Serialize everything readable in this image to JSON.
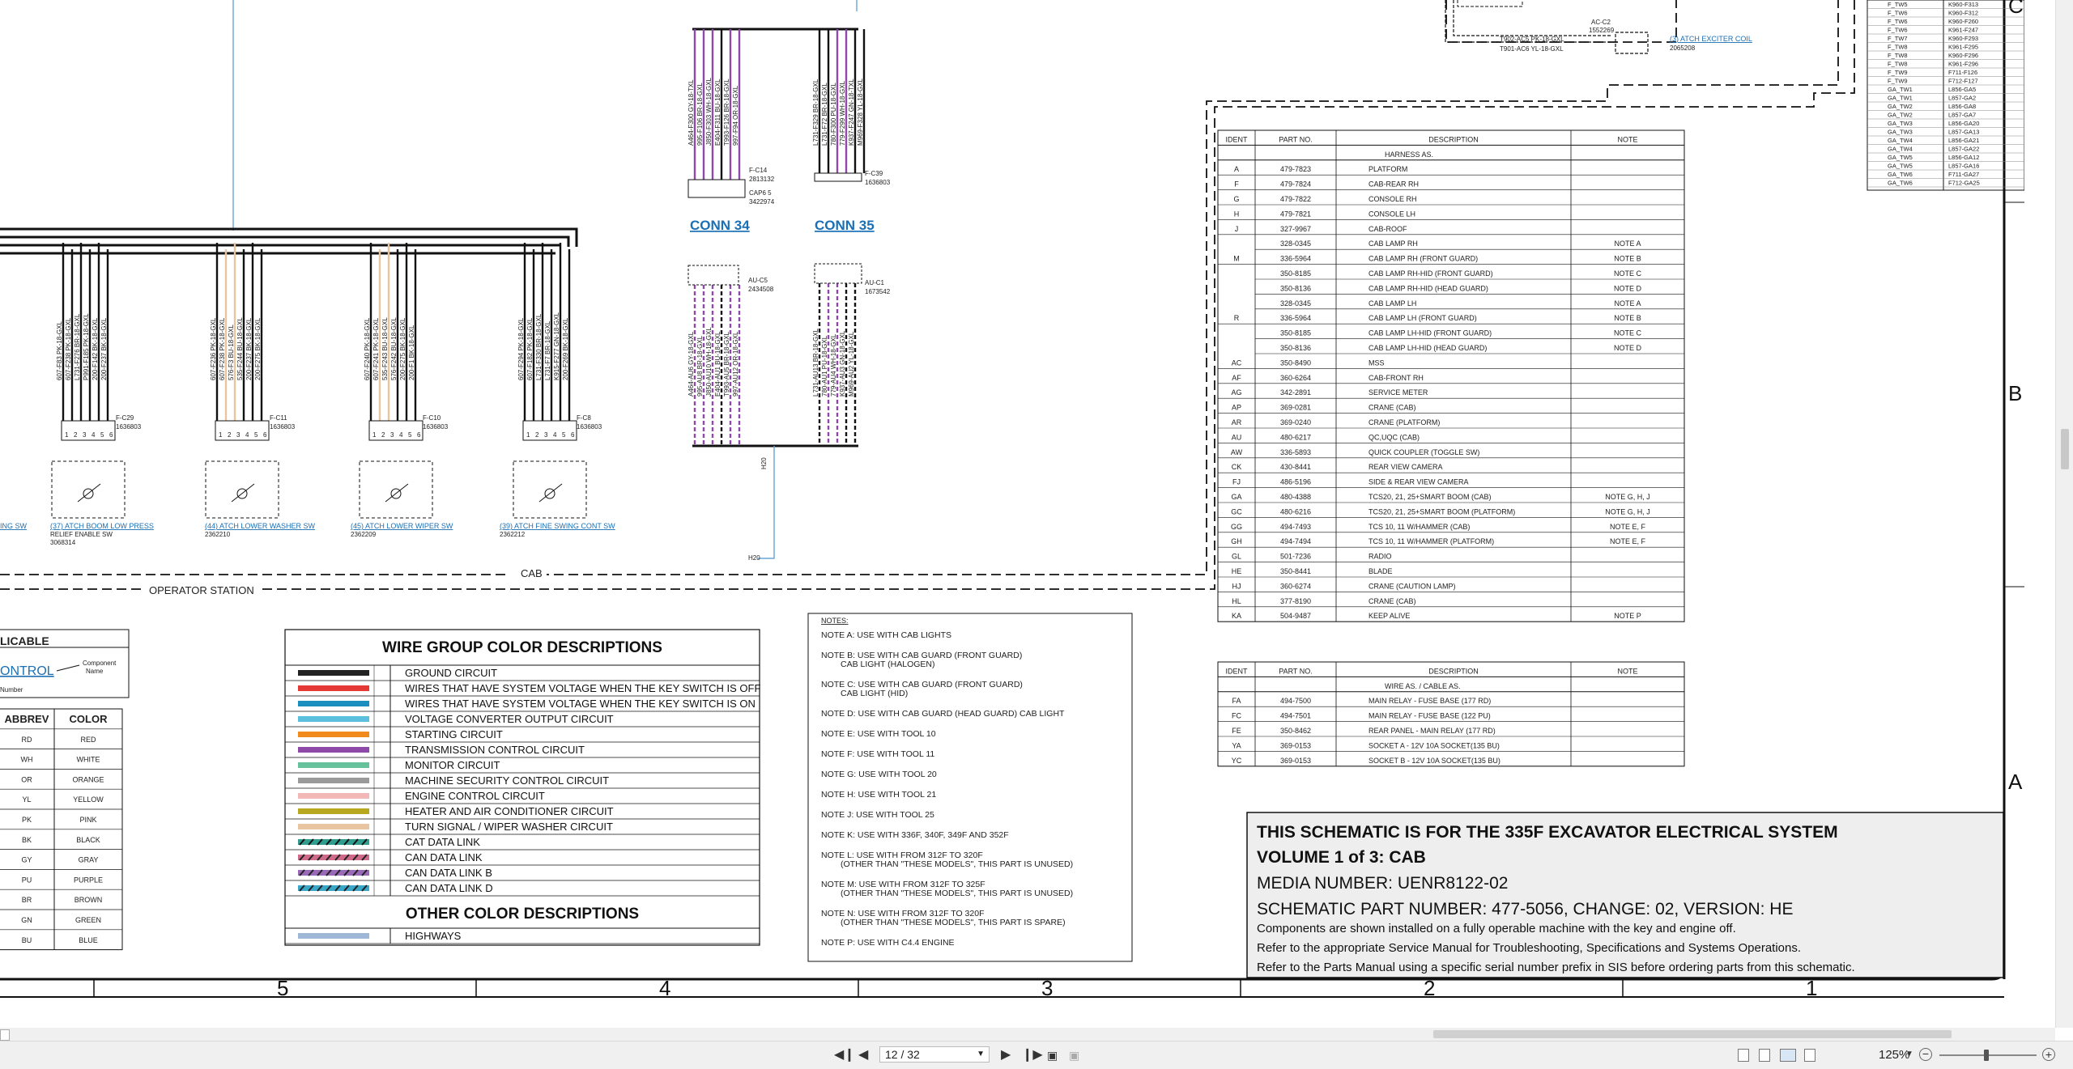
{
  "connectors": {
    "conn34": "CONN 34",
    "conn35": "CONN 35",
    "fc14": "F-C14",
    "fc14pn": "2813132",
    "cap": "CAP6 5",
    "cappn": "3422974",
    "fc39": "F-C39",
    "fc39pn": "1636803",
    "auc5": "AU-C5",
    "auc5pn": "2434508",
    "auc1": "AU-C1",
    "auc1pn": "1673542",
    "fc29": "F-C29",
    "fc29pn": "1636803",
    "fc11": "F-C11",
    "fc11pn": "1636803",
    "fc10": "F-C10",
    "fc10pn": "1636803",
    "fc8": "F-C8",
    "fc8pn": "1636803",
    "acc2": "AC-C2",
    "acc2pn": "1552269",
    "h20": "H20"
  },
  "switches": {
    "sw1": "(37) ATCH BOOM LOW PRESS",
    "sw1b": "RELIEF ENABLE SW",
    "sw1pn": "3068314",
    "sw2": "(44) ATCH LOWER WASHER SW",
    "sw2pn": "2362210",
    "sw3": "(45) ATCH LOWER WIPER SW",
    "sw3pn": "2362209",
    "sw4": "(39) ATCH FINE SWING CONT SW",
    "sw4pn": "2362212",
    "sw0": "ING SW",
    "exciter": "(3) ATCH EXCITER COIL",
    "exciterpn": "2065208",
    "w1": "T902-AC5 PK-18-GXL",
    "w2": "T901-AC6 YL-18-GXL"
  },
  "labels": {
    "cab": "CAB",
    "operator": "OPERATOR STATION"
  },
  "wire_group": {
    "title": "WIRE GROUP COLOR DESCRIPTIONS",
    "rows": [
      {
        "label": "GROUND CIRCUIT",
        "color": "#222222"
      },
      {
        "label": "WIRES THAT HAVE SYSTEM VOLTAGE WHEN THE KEY SWITCH IS OFF",
        "color": "#e53935"
      },
      {
        "label": "WIRES THAT HAVE SYSTEM VOLTAGE WHEN THE KEY SWITCH IS ON",
        "color": "#1a8fbf"
      },
      {
        "label": "VOLTAGE CONVERTER OUTPUT CIRCUIT",
        "color": "#5bc0de"
      },
      {
        "label": "STARTING CIRCUIT",
        "color": "#f08a1c"
      },
      {
        "label": "TRANSMISSION CONTROL CIRCUIT",
        "color": "#8e4aa8"
      },
      {
        "label": "MONITOR CIRCUIT",
        "color": "#66c29a"
      },
      {
        "label": "MACHINE SECURITY CONTROL CIRCUIT",
        "color": "#9a9a9a"
      },
      {
        "label": "ENGINE CONTROL CIRCUIT",
        "color": "#f2b7b7"
      },
      {
        "label": "HEATER AND AIR CONDITIONER CIRCUIT",
        "color": "#b8a820"
      },
      {
        "label": "TURN SIGNAL / WIPER WASHER CIRCUIT",
        "color": "#e8c4a0"
      },
      {
        "label": "CAT DATA LINK",
        "color": "#2f9e8f"
      },
      {
        "label": "CAN DATA LINK",
        "color": "#d06a8a"
      },
      {
        "label": "CAN DATA LINK B",
        "color": "#9a6ab8"
      },
      {
        "label": "CAN DATA LINK D",
        "color": "#3aa6c8"
      }
    ],
    "other_title": "OTHER COLOR DESCRIPTIONS",
    "other": [
      {
        "label": "HIGHWAYS",
        "color": "#9fb8d8"
      }
    ]
  },
  "applicable": {
    "title": "LICABLE",
    "control": "ONTROL",
    "component": "Component",
    "name": "Name",
    "number": "Number"
  },
  "color_table": {
    "headers": [
      "ABBREV",
      "COLOR"
    ],
    "rows": [
      [
        "RD",
        "RED"
      ],
      [
        "WH",
        "WHITE"
      ],
      [
        "OR",
        "ORANGE"
      ],
      [
        "YL",
        "YELLOW"
      ],
      [
        "PK",
        "PINK"
      ],
      [
        "BK",
        "BLACK"
      ],
      [
        "GY",
        "GRAY"
      ],
      [
        "PU",
        "PURPLE"
      ],
      [
        "BR",
        "BROWN"
      ],
      [
        "GN",
        "GREEN"
      ],
      [
        "BU",
        "BLUE"
      ]
    ]
  },
  "notes": {
    "title": "NOTES:",
    "items": [
      [
        "NOTE A: USE WITH CAB LIGHTS"
      ],
      [
        "NOTE B: USE WITH CAB GUARD (FRONT GUARD)",
        "CAB LIGHT (HALOGEN)"
      ],
      [
        "NOTE C: USE WITH CAB GUARD (FRONT GUARD)",
        "CAB LIGHT (HID)"
      ],
      [
        "NOTE D: USE WITH CAB GUARD (HEAD GUARD) CAB LIGHT"
      ],
      [
        "NOTE E: USE WITH TOOL 10"
      ],
      [
        "NOTE F: USE WITH TOOL 11"
      ],
      [
        "NOTE G: USE WITH TOOL 20"
      ],
      [
        "NOTE H: USE WITH TOOL 21"
      ],
      [
        "NOTE J: USE WITH TOOL 25"
      ],
      [
        "NOTE K: USE WITH 336F, 340F, 349F AND 352F"
      ],
      [
        "NOTE L: USE WITH FROM 312F TO 320F",
        "(OTHER THAN \"THESE MODELS\", THIS PART IS UNUSED)"
      ],
      [
        "NOTE M: USE WITH FROM 312F TO 325F",
        "(OTHER THAN \"THESE MODELS\", THIS PART IS UNUSED)"
      ],
      [
        "NOTE N: USE WITH FROM 312F TO 320F",
        "(OTHER THAN \"THESE MODELS\", THIS PART IS SPARE)"
      ],
      [
        "NOTE P: USE WITH C4.4 ENGINE"
      ]
    ]
  },
  "harness": {
    "headers": [
      "IDENT",
      "PART NO.",
      "DESCRIPTION",
      "NOTE"
    ],
    "subtitle": "HARNESS AS.",
    "rows": [
      [
        "A",
        "479-7823",
        "PLATFORM",
        ""
      ],
      [
        "F",
        "479-7824",
        "CAB-REAR RH",
        ""
      ],
      [
        "G",
        "479-7822",
        "CONSOLE RH",
        ""
      ],
      [
        "H",
        "479-7821",
        "CONSOLE LH",
        ""
      ],
      [
        "J",
        "327-9967",
        "CAB-ROOF",
        ""
      ],
      [
        "",
        "328-0345",
        "CAB LAMP RH",
        "NOTE A"
      ],
      [
        "M",
        "336-5964",
        "CAB LAMP RH (FRONT GUARD)",
        "NOTE B"
      ],
      [
        "",
        "350-8185",
        "CAB LAMP RH-HID (FRONT GUARD)",
        "NOTE C"
      ],
      [
        "",
        "350-8136",
        "CAB LAMP RH-HID (HEAD GUARD)",
        "NOTE D"
      ],
      [
        "",
        "328-0345",
        "CAB LAMP LH",
        "NOTE A"
      ],
      [
        "R",
        "336-5964",
        "CAB LAMP LH (FRONT GUARD)",
        "NOTE B"
      ],
      [
        "",
        "350-8185",
        "CAB LAMP LH-HID (FRONT GUARD)",
        "NOTE C"
      ],
      [
        "",
        "350-8136",
        "CAB LAMP LH-HID (HEAD GUARD)",
        "NOTE D"
      ],
      [
        "AC",
        "350-8490",
        "MSS",
        ""
      ],
      [
        "AF",
        "360-6264",
        "CAB-FRONT RH",
        ""
      ],
      [
        "AG",
        "342-2891",
        "SERVICE METER",
        ""
      ],
      [
        "AP",
        "369-0281",
        "CRANE (CAB)",
        ""
      ],
      [
        "AR",
        "369-0240",
        "CRANE (PLATFORM)",
        ""
      ],
      [
        "AU",
        "480-6217",
        "QC,UQC (CAB)",
        ""
      ],
      [
        "AW",
        "336-5893",
        "QUICK COUPLER (TOGGLE SW)",
        ""
      ],
      [
        "CK",
        "430-8441",
        "REAR VIEW CAMERA",
        ""
      ],
      [
        "FJ",
        "486-5196",
        "SIDE & REAR VIEW CAMERA",
        ""
      ],
      [
        "GA",
        "480-4388",
        "TCS20, 21, 25+SMART BOOM (CAB)",
        "NOTE G, H, J"
      ],
      [
        "GC",
        "480-6216",
        "TCS20, 21, 25+SMART BOOM (PLATFORM)",
        "NOTE G, H, J"
      ],
      [
        "GG",
        "494-7493",
        "TCS 10, 11 W/HAMMER (CAB)",
        "NOTE E, F"
      ],
      [
        "GH",
        "494-7494",
        "TCS 10, 11 W/HAMMER (PLATFORM)",
        "NOTE E, F"
      ],
      [
        "GL",
        "501-7236",
        "RADIO",
        ""
      ],
      [
        "HE",
        "350-8441",
        "BLADE",
        ""
      ],
      [
        "HJ",
        "360-6274",
        "CRANE (CAUTION LAMP)",
        ""
      ],
      [
        "HL",
        "377-8190",
        "CRANE (CAB)",
        ""
      ],
      [
        "KA",
        "504-9487",
        "KEEP ALIVE",
        "NOTE P"
      ]
    ]
  },
  "wire_as": {
    "headers": [
      "IDENT",
      "PART NO.",
      "DESCRIPTION",
      "NOTE"
    ],
    "subtitle": "WIRE AS. / CABLE AS.",
    "rows": [
      [
        "FA",
        "494-7500",
        "MAIN RELAY - FUSE BASE (177 RD)",
        ""
      ],
      [
        "FC",
        "494-7501",
        "MAIN RELAY - FUSE BASE (122 PU)",
        ""
      ],
      [
        "FE",
        "350-8462",
        "REAR PANEL - MAIN RELAY (177 RD)",
        ""
      ],
      [
        "YA",
        "369-0153",
        "SOCKET A - 12V 10A SOCKET(135 BU)",
        ""
      ],
      [
        "YC",
        "369-0153",
        "SOCKET B - 12V 10A SOCKET(135 BU)",
        ""
      ]
    ]
  },
  "twist_table": {
    "rows": [
      [
        "F_TW5",
        "K960-F313"
      ],
      [
        "F_TW6",
        "K960-F312"
      ],
      [
        "F_TW6",
        "K960-F260"
      ],
      [
        "F_TW6",
        "K961-F247"
      ],
      [
        "F_TW7",
        "K960-F293"
      ],
      [
        "F_TW8",
        "K961-F295"
      ],
      [
        "F_TW8",
        "K960-F296"
      ],
      [
        "F_TW8",
        "K961-F296"
      ],
      [
        "F_TW9",
        "F711-F126"
      ],
      [
        "F_TW9",
        "F712-F127"
      ],
      [
        "GA_TW1",
        "L856-GA5"
      ],
      [
        "GA_TW1",
        "L857-GA2"
      ],
      [
        "GA_TW2",
        "L856-GA8"
      ],
      [
        "GA_TW2",
        "L857-GA7"
      ],
      [
        "GA_TW3",
        "L856-GA20"
      ],
      [
        "GA_TW3",
        "L857-GA13"
      ],
      [
        "GA_TW4",
        "L856-GA21"
      ],
      [
        "GA_TW4",
        "L857-GA22"
      ],
      [
        "GA_TW5",
        "L856-GA12"
      ],
      [
        "GA_TW5",
        "L857-GA16"
      ],
      [
        "GA_TW6",
        "F711-GA27"
      ],
      [
        "GA_TW6",
        "F712-GA25"
      ]
    ]
  },
  "zones": {
    "rows": [
      "C",
      "B",
      "A"
    ],
    "cols": [
      "5",
      "4",
      "3",
      "2",
      "1"
    ]
  },
  "title_block": {
    "line1": "THIS SCHEMATIC IS FOR THE 335F EXCAVATOR ELECTRICAL SYSTEM",
    "line2": "VOLUME 1 of 3: CAB",
    "line3": "MEDIA NUMBER: UENR8122-02",
    "line4": "SCHEMATIC PART NUMBER: 477-5056, CHANGE: 02, VERSION: HE",
    "line5": "Components are shown installed on a fully operable machine with the key and engine off.",
    "line6": "Refer to the appropriate Service Manual for Troubleshooting, Specifications and Systems Operations.",
    "line7": "Refer to the Parts Manual using a specific serial number prefix in SIS before ordering parts from this schematic."
  },
  "wire_labels": {
    "g1": [
      "607-F83 PK-18-GXL",
      "607-F238 PK-18-GXL",
      "L731-F276 BR-18-GXL",
      "P991-F185 PK-18-GXL",
      "200-F142 BK-18-GXL",
      "200-F237 BK-18-GXL"
    ],
    "g2": [
      "607-F236 PK-18-GXL",
      "607-F238 PK-18-GXL",
      "576-F3 BU-18-GXL",
      "535-F244 BU-18-GXL",
      "200-F237 BK-18-GXL",
      "200-F275 BK-18-GXL"
    ],
    "g3": [
      "607-F240 PK-18-GXL",
      "607-F241 PK-18-GXL",
      "535-F243 BU-18-GXL",
      "576-F242 BU-18-GXL",
      "200-F275 BK-18-GXL",
      "200-F1 BK-18-GXL"
    ],
    "g4": [
      "607-F294 PK-18-GXL",
      "607-F182 PK-18-GXL",
      "L731-F330 BR-18-GXL",
      "L731-F7 BR-18-GXL",
      "K915-F277 GN-18-GXL",
      "200-F269 BK-18-GXL"
    ],
    "c34": [
      "A464-F300 GY-18-TXL",
      "995-F106 BR-18-GXL",
      "J850-F303 WH-18-GXL",
      "E404-F311 BU-18-GXL",
      "T993-F126 BR-18-GXL",
      "997-F94 OR-18-GXL"
    ],
    "c35": [
      "L731-F329 BR-18-GXL",
      "L731-F72 BR-18-GXL",
      "780-F300 PU-18-GXL",
      "779-F299 WH-18-GXL",
      "K937-F247 GN-18-TXL",
      "M969-F328 YL-18-GXL"
    ],
    "c34b": [
      "A464-AU6 GY-18-GXL",
      "995-AU8 BR-18-GXL",
      "J850-AU10 WH-18-GXL",
      "E404-AU1 BU-18-GXL",
      "T993-AU5 BR-18-GXL",
      "997-AU12 OR-18-GXL"
    ],
    "c35b": [
      "L731-AU13 BR-18-GXL",
      "780-AU1 PU-18-GXL",
      "779-AU4 WH-18-GXL",
      "K937-AU3 GN-18-GXL",
      "M969-AU2 YL-18-GXL"
    ]
  },
  "toolbar": {
    "page_value": "12 / 32",
    "zoom_value": "125%",
    "first": "first-page",
    "prev": "previous-page",
    "next": "next-page",
    "last": "last-page"
  }
}
